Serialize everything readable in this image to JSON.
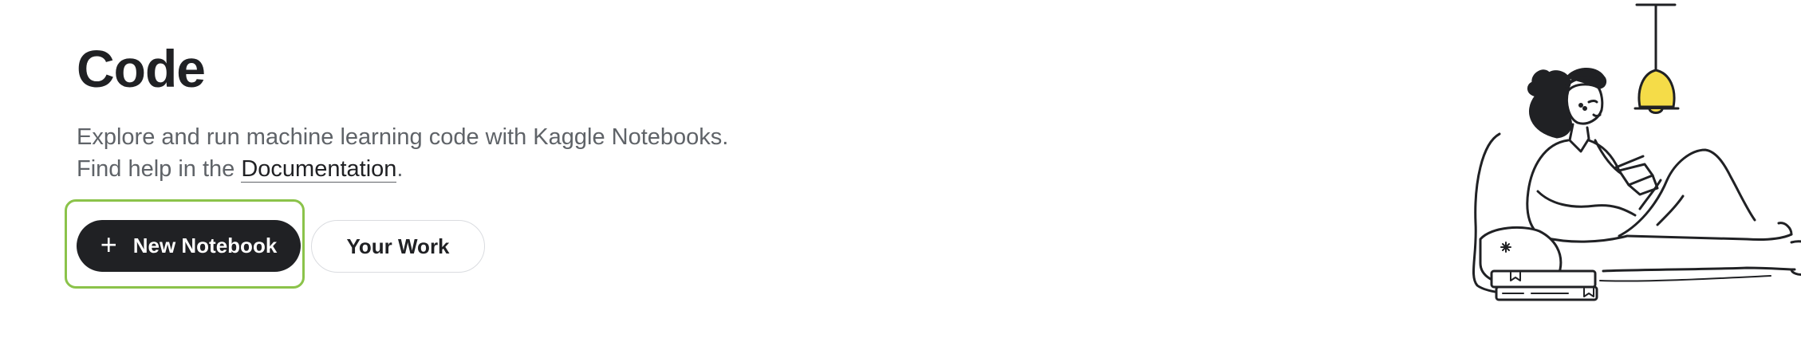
{
  "header": {
    "title": "Code"
  },
  "description": {
    "line1": "Explore and run machine learning code with Kaggle Notebooks.",
    "line2_prefix": "Find help in the ",
    "documentation_link": "Documentation",
    "line2_suffix": "."
  },
  "actions": {
    "new_notebook_icon": "+",
    "new_notebook_label": "New Notebook",
    "your_work_label": "Your Work"
  },
  "illustration": {
    "description_icon": "person-reading-under-lamp-illustration"
  },
  "colors": {
    "primary_button": "#202124",
    "focus_ring": "#8bc34a",
    "lamp_yellow": "#f5dc48",
    "text_muted": "#5f6368"
  }
}
